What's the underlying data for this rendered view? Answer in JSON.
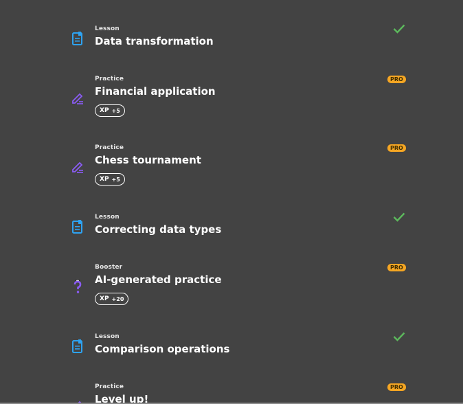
{
  "items": [
    {
      "type": "Lesson",
      "title": "Data transformation",
      "status": "completed",
      "icon": "lesson-icon"
    },
    {
      "type": "Practice",
      "title": "Financial application",
      "badge": "PRO",
      "xp_label": "XP",
      "xp_value": "+5",
      "icon": "practice-pencil-icon"
    },
    {
      "type": "Practice",
      "title": "Chess tournament",
      "badge": "PRO",
      "xp_label": "XP",
      "xp_value": "+5",
      "icon": "practice-pencil-icon"
    },
    {
      "type": "Lesson",
      "title": "Correcting data types",
      "status": "completed",
      "icon": "lesson-icon"
    },
    {
      "type": "Booster",
      "title": "AI-generated practice",
      "badge": "PRO",
      "xp_label": "XP",
      "xp_value": "+20",
      "icon": "booster-question-icon"
    },
    {
      "type": "Lesson",
      "title": "Comparison operations",
      "status": "completed",
      "icon": "lesson-icon"
    },
    {
      "type": "Practice",
      "title": "Level up!",
      "badge": "PRO",
      "icon": "practice-pencil-icon"
    }
  ],
  "colors": {
    "background": "#434343",
    "lesson_icon": "#2ea3f2",
    "practice_icon": "#8b5cf6",
    "check": "#5cb85c",
    "pro_badge": "#f5a623"
  }
}
